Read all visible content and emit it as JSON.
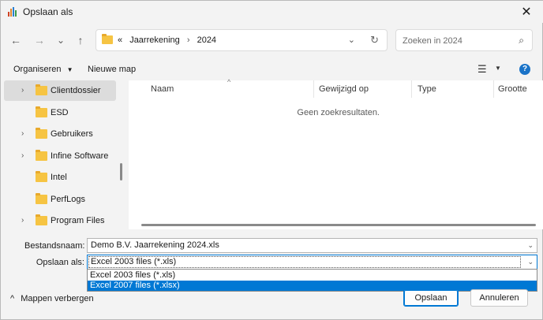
{
  "window": {
    "title": "Opslaan als",
    "close_glyph": "✕"
  },
  "nav": {
    "back_glyph": "←",
    "forward_glyph": "→",
    "recent_glyph": "⌄",
    "up_glyph": "↑",
    "crumb_overflow": "«",
    "breadcrumbs": [
      "Jaarrekening",
      "2024"
    ],
    "crumb_sep": "›",
    "refresh_glyph": "↻",
    "search_placeholder": "Zoeken in 2024",
    "search_glyph": "⌕"
  },
  "toolbar": {
    "organize_label": "Organiseren",
    "new_folder_label": "Nieuwe map",
    "view_glyph": "☰",
    "help_glyph": "?"
  },
  "navpane": {
    "items": [
      {
        "label": "Clientdossier",
        "has_children": true,
        "selected": true
      },
      {
        "label": "ESD",
        "has_children": false,
        "selected": false
      },
      {
        "label": "Gebruikers",
        "has_children": true,
        "selected": false
      },
      {
        "label": "Infine Software",
        "has_children": true,
        "selected": false
      },
      {
        "label": "Intel",
        "has_children": false,
        "selected": false
      },
      {
        "label": "PerfLogs",
        "has_children": false,
        "selected": false
      },
      {
        "label": "Program Files",
        "has_children": true,
        "selected": false
      }
    ]
  },
  "filelist": {
    "columns": [
      "Naam",
      "Gewijzigd op",
      "Type",
      "Grootte"
    ],
    "empty_message": "Geen zoekresultaten."
  },
  "form": {
    "filename_label": "Bestandsnaam:",
    "filename_value": "Demo B.V. Jaarrekening 2024.xls",
    "saveas_label": "Opslaan als:",
    "saveas_value": "Excel 2003 files (*.xls)",
    "saveas_options": [
      "Excel 2003 files (*.xls)",
      "Excel 2007 files (*.xlsx)"
    ],
    "highlighted_option": "Excel 2007 files (*.xlsx)"
  },
  "footer": {
    "toggle_label": "Mappen verbergen",
    "save_label": "Opslaan",
    "cancel_label": "Annuleren"
  },
  "colors": {
    "accent": "#0078d4",
    "folder": "#f6c443",
    "selection": "#dcdcdc"
  }
}
